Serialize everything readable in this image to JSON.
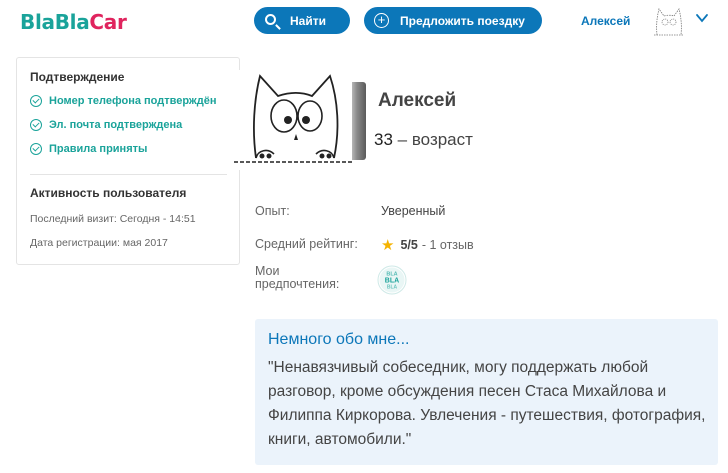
{
  "header": {
    "logo_part1": "Bla",
    "logo_part2": "Bla",
    "logo_part3": "Car",
    "find_label": "Найти",
    "offer_label": "Предложить поездку",
    "user_name": "Алексей"
  },
  "verification": {
    "title": "Подтверждение",
    "items": [
      "Номер телефона подтверждён",
      "Эл. почта подтверждена",
      "Правила приняты"
    ]
  },
  "activity": {
    "title": "Активность пользователя",
    "last_visit": "Последний визит: Сегодня - 14:51",
    "registered": "Дата регистрации: мая 2017"
  },
  "profile": {
    "name": "Алексей",
    "age_number": "33",
    "age_suffix": "– возраст",
    "experience_label": "Опыт:",
    "experience_value": "Уверенный",
    "rating_label": "Средний рейтинг:",
    "rating_value": "5/5",
    "rating_reviews": "- 1 отзыв",
    "preferences_label_line1": "Мои",
    "preferences_label_line2": "предпочтения:",
    "preference_badge": [
      "BLA",
      "BLA",
      "BLA"
    ]
  },
  "about": {
    "title": "Немного обо мне...",
    "text": "\"Ненавязчивый собеседник, могу поддержать любой разговор, кроме обсуждения песен Стаса Михайлова и Филиппа Киркорова. Увлечения - путешествия, фотография, книги, автомобили.\""
  },
  "colors": {
    "brand_teal": "#1aa39a",
    "brand_pink": "#e0245e",
    "primary_blue": "#0c77b9",
    "about_bg": "#ebf3fb",
    "star": "#f5b301"
  },
  "icons": [
    "search-icon",
    "plus-circle-icon",
    "chevron-down-icon",
    "check-circle-icon",
    "star-icon"
  ]
}
